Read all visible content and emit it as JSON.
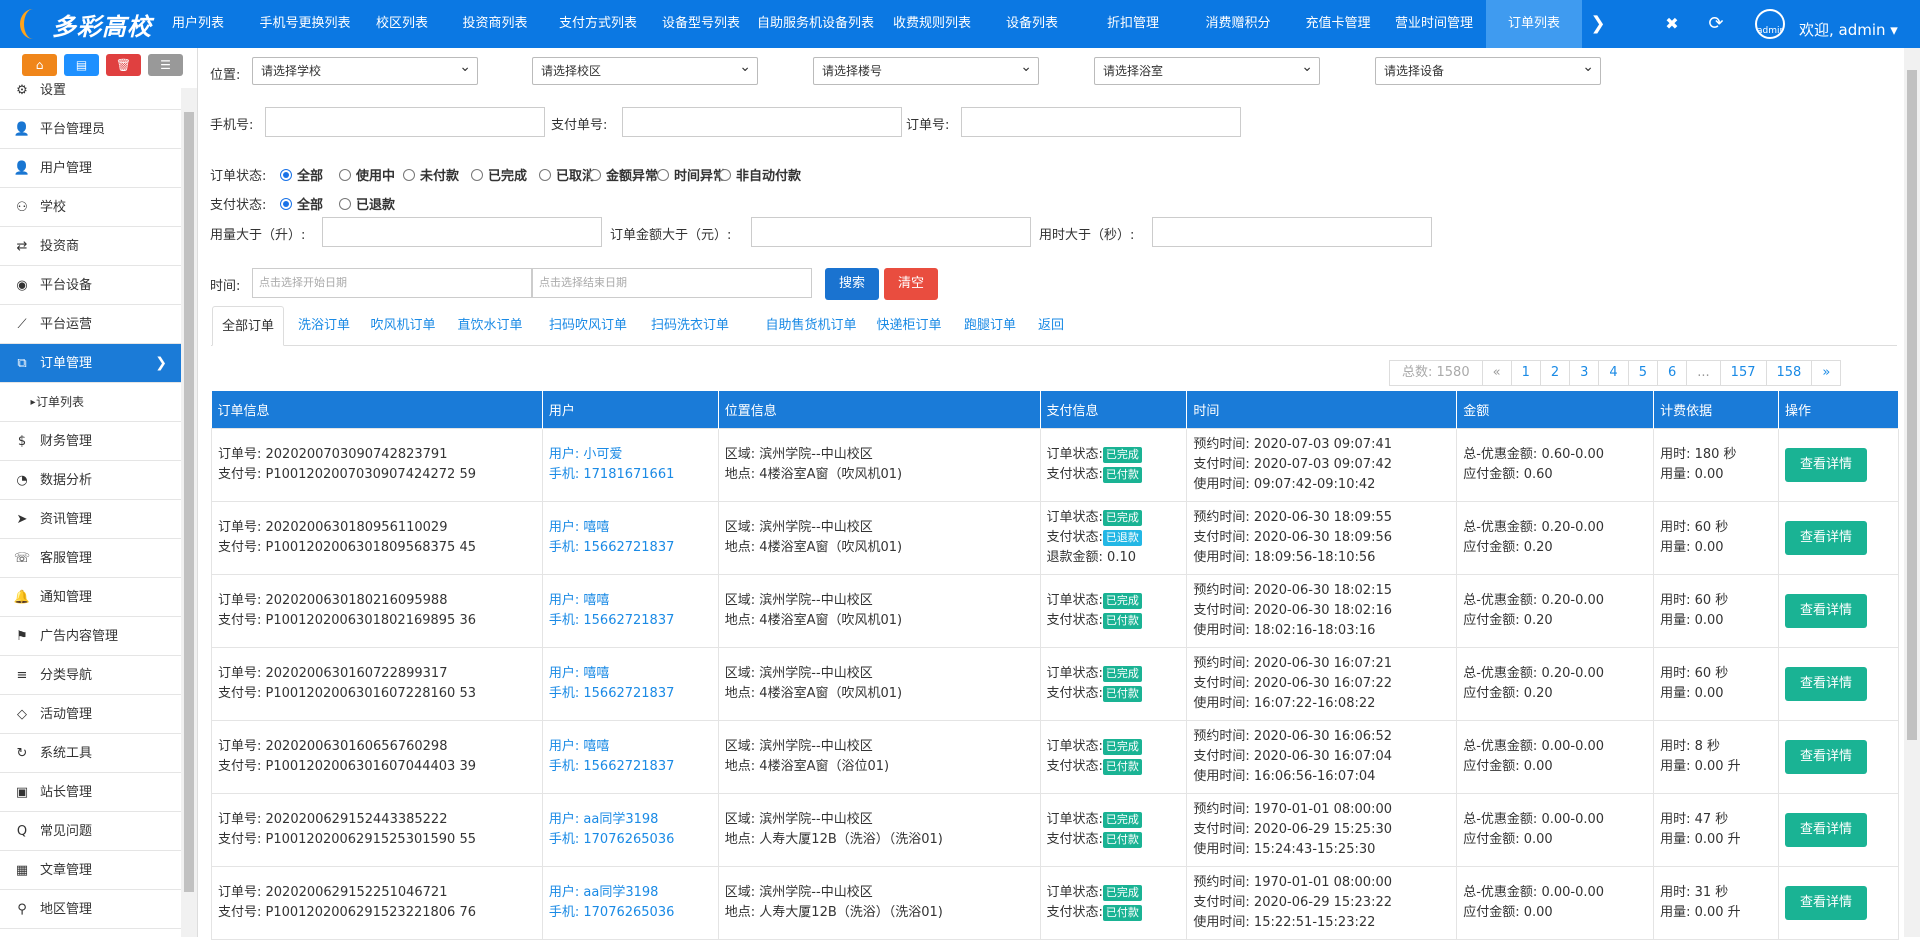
{
  "app": {
    "logo_text": "多彩高校"
  },
  "topnav": {
    "items": [
      "用户列表",
      "手机号更换列表",
      "校区列表",
      "投资商列表",
      "支付方式列表",
      "设备型号列表",
      "自助服务机设备列表",
      "收费规则列表",
      "设备列表",
      "折扣管理",
      "消费赠积分",
      "充值卡管理",
      "营业时间管理",
      "订单列表"
    ],
    "active": "订单列表",
    "next_icon": "chevron-right-icon",
    "close_icon": "close-icon",
    "refresh_icon": "refresh-icon",
    "avatar_alt": "admin",
    "welcome": "欢迎, admin ▾"
  },
  "sidebar": {
    "quick_buttons": [
      {
        "icon": "home-icon",
        "color": "#f0861a"
      },
      {
        "icon": "file-icon",
        "color": "#1e90ff"
      },
      {
        "icon": "trash-icon",
        "color": "#e04040"
      },
      {
        "icon": "list-icon",
        "color": "#999999"
      }
    ],
    "items": [
      {
        "label": "设置",
        "icon": "⚙"
      },
      {
        "label": "平台管理员",
        "icon": "👤"
      },
      {
        "label": "用户管理",
        "icon": "👤"
      },
      {
        "label": "学校",
        "icon": "⚇"
      },
      {
        "label": "投资商",
        "icon": "⇄"
      },
      {
        "label": "平台设备",
        "icon": "◉"
      },
      {
        "label": "平台运营",
        "icon": "⟋"
      },
      {
        "label": "订单管理",
        "icon": "⧉",
        "active": true
      },
      {
        "label": "订单列表",
        "icon": "▸",
        "sub": true
      },
      {
        "label": "财务管理",
        "icon": "$"
      },
      {
        "label": "数据分析",
        "icon": "◔"
      },
      {
        "label": "资讯管理",
        "icon": "➤"
      },
      {
        "label": "客服管理",
        "icon": "☏"
      },
      {
        "label": "通知管理",
        "icon": "🔔"
      },
      {
        "label": "广告内容管理",
        "icon": "⚑"
      },
      {
        "label": "分类导航",
        "icon": "≡"
      },
      {
        "label": "活动管理",
        "icon": "◇"
      },
      {
        "label": "系统工具",
        "icon": "↻"
      },
      {
        "label": "站长管理",
        "icon": "▣"
      },
      {
        "label": "常见问题",
        "icon": "Q"
      },
      {
        "label": "文章管理",
        "icon": "▦"
      },
      {
        "label": "地区管理",
        "icon": "⚲"
      }
    ]
  },
  "filters": {
    "location_label": "位置:",
    "selects": [
      "请选择学校",
      "请选择校区",
      "请选择楼号",
      "请选择浴室",
      "请选择设备"
    ],
    "phone_label": "手机号:",
    "pay_no_label": "支付单号:",
    "order_no_label": "订单号:",
    "order_status_label": "订单状态:",
    "order_status_options": [
      "全部",
      "使用中",
      "未付款",
      "已完成",
      "已取消",
      "金额异常",
      "时间异常",
      "非自动付款"
    ],
    "pay_status_label": "支付状态:",
    "pay_status_options": [
      "全部",
      "已退款"
    ],
    "usage_label": "用量大于（升）:",
    "amount_label": "订单金额大于（元）:",
    "duration_label": "用时大于（秒）:",
    "time_label": "时间:",
    "start_placeholder": "点击选择开始日期",
    "end_placeholder": "点击选择结束日期",
    "search_button": "搜索",
    "clear_button": "清空"
  },
  "tabs": [
    "全部订单",
    "洗浴订单",
    "吹风机订单",
    "直饮水订单",
    "扫码吹风订单",
    "扫码洗衣订单",
    "自助售货机订单",
    "快递柜订单",
    "跑腿订单",
    "返回"
  ],
  "pager": {
    "total": "总数: 1580",
    "prev": "«",
    "pages": [
      "1",
      "2",
      "3",
      "4",
      "5",
      "6",
      "...",
      "157",
      "158"
    ],
    "next": "»"
  },
  "table": {
    "headers": [
      "订单信息",
      "用户",
      "位置信息",
      "支付信息",
      "时间",
      "金额",
      "计费依据",
      "操作"
    ],
    "rows": [
      {
        "order_no": "订单号: 2020200703090742823791",
        "pay_no": "支付号: P1001202007030907424272 59",
        "user": "用户: 小可爱",
        "phone": "手机: 17181671661",
        "area": "区域: 滨州学院--中山校区",
        "place": "地点: 4楼浴室A窗（吹风机01)",
        "order_status": "已完成",
        "pay_status": "已付款",
        "refund": "",
        "reserve": "预约时间: 2020-07-03 09:07:41",
        "paid": "支付时间: 2020-07-03 09:07:42",
        "used": "使用时间: 09:07:42-09:10:42",
        "total": "总-优惠金额: 0.60-0.00",
        "due": "应付金额: 0.60",
        "dur": "用时: 180 秒",
        "vol": "用量: 0.00",
        "action": "查看详情"
      },
      {
        "order_no": "订单号: 2020200630180956110029",
        "pay_no": "支付号: P1001202006301809568375 45",
        "user": "用户: 嘻嘻",
        "phone": "手机: 15662721837",
        "area": "区域: 滨州学院--中山校区",
        "place": "地点: 4楼浴室A窗（吹风机01)",
        "order_status": "已完成",
        "pay_status": "已退款",
        "refund": "退款金额: 0.10",
        "reserve": "预约时间: 2020-06-30 18:09:55",
        "paid": "支付时间: 2020-06-30 18:09:56",
        "used": "使用时间: 18:09:56-18:10:56",
        "total": "总-优惠金额: 0.20-0.00",
        "due": "应付金额: 0.20",
        "dur": "用时: 60 秒",
        "vol": "用量: 0.00",
        "action": "查看详情"
      },
      {
        "order_no": "订单号: 2020200630180216095988",
        "pay_no": "支付号: P1001202006301802169895 36",
        "user": "用户: 嘻嘻",
        "phone": "手机: 15662721837",
        "area": "区域: 滨州学院--中山校区",
        "place": "地点: 4楼浴室A窗（吹风机01)",
        "order_status": "已完成",
        "pay_status": "已付款",
        "refund": "",
        "reserve": "预约时间: 2020-06-30 18:02:15",
        "paid": "支付时间: 2020-06-30 18:02:16",
        "used": "使用时间: 18:02:16-18:03:16",
        "total": "总-优惠金额: 0.20-0.00",
        "due": "应付金额: 0.20",
        "dur": "用时: 60 秒",
        "vol": "用量: 0.00",
        "action": "查看详情"
      },
      {
        "order_no": "订单号: 2020200630160722899317",
        "pay_no": "支付号: P1001202006301607228160 53",
        "user": "用户: 嘻嘻",
        "phone": "手机: 15662721837",
        "area": "区域: 滨州学院--中山校区",
        "place": "地点: 4楼浴室A窗（吹风机01)",
        "order_status": "已完成",
        "pay_status": "已付款",
        "refund": "",
        "reserve": "预约时间: 2020-06-30 16:07:21",
        "paid": "支付时间: 2020-06-30 16:07:22",
        "used": "使用时间: 16:07:22-16:08:22",
        "total": "总-优惠金额: 0.20-0.00",
        "due": "应付金额: 0.20",
        "dur": "用时: 60 秒",
        "vol": "用量: 0.00",
        "action": "查看详情"
      },
      {
        "order_no": "订单号: 2020200630160656760298",
        "pay_no": "支付号: P1001202006301607044403 39",
        "user": "用户: 嘻嘻",
        "phone": "手机: 15662721837",
        "area": "区域: 滨州学院--中山校区",
        "place": "地点: 4楼浴室A窗（浴位01)",
        "order_status": "已完成",
        "pay_status": "已付款",
        "refund": "",
        "reserve": "预约时间: 2020-06-30 16:06:52",
        "paid": "支付时间: 2020-06-30 16:07:04",
        "used": "使用时间: 16:06:56-16:07:04",
        "total": "总-优惠金额: 0.00-0.00",
        "due": "应付金额: 0.00",
        "dur": "用时: 8 秒",
        "vol": "用量: 0.00 升",
        "action": "查看详情"
      },
      {
        "order_no": "订单号: 2020200629152443385222",
        "pay_no": "支付号: P1001202006291525301590 55",
        "user": "用户: aa同学3198",
        "phone": "手机: 17076265036",
        "area": "区域: 滨州学院--中山校区",
        "place": "地点: 人寿大厦12B（洗浴）（洗浴01)",
        "order_status": "已完成",
        "pay_status": "已付款",
        "refund": "",
        "reserve": "预约时间: 1970-01-01 08:00:00",
        "paid": "支付时间: 2020-06-29 15:25:30",
        "used": "使用时间: 15:24:43-15:25:30",
        "total": "总-优惠金额: 0.00-0.00",
        "due": "应付金额: 0.00",
        "dur": "用时: 47 秒",
        "vol": "用量: 0.00 升",
        "action": "查看详情"
      },
      {
        "order_no": "订单号: 2020200629152251046721",
        "pay_no": "支付号: P1001202006291523221806 76",
        "user": "用户: aa同学3198",
        "phone": "手机: 17076265036",
        "area": "区域: 滨州学院--中山校区",
        "place": "地点: 人寿大厦12B（洗浴）（洗浴01)",
        "order_status": "已完成",
        "pay_status": "已付款",
        "refund": "",
        "reserve": "预约时间: 1970-01-01 08:00:00",
        "paid": "支付时间: 2020-06-29 15:23:22",
        "used": "使用时间: 15:22:51-15:23:22",
        "total": "总-优惠金额: 0.00-0.00",
        "due": "应付金额: 0.00",
        "dur": "用时: 31 秒",
        "vol": "用量: 0.00 升",
        "action": "查看详情"
      }
    ],
    "order_status_prefix": "订单状态:",
    "pay_status_prefix": "支付状态:"
  }
}
